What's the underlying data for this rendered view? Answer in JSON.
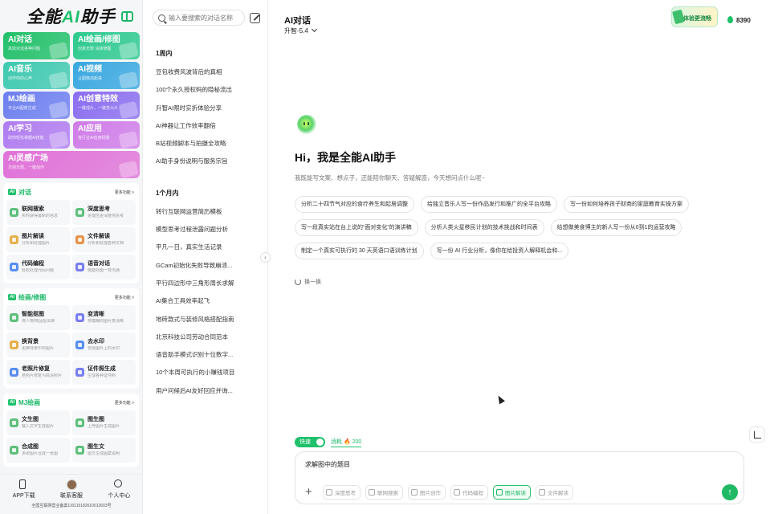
{
  "sidebar": {
    "logo_prefix": "全能",
    "logo_ai": "AI",
    "logo_suffix": "助手",
    "tiles": [
      {
        "title": "AI对话",
        "sub": "高效对话各种问题",
        "color": "#22c06a"
      },
      {
        "title": "AI绘画/修图",
        "sub": "创意无限 涂抹修图",
        "color": "#2dc98f"
      },
      {
        "title": "AI音乐",
        "sub": "创作你的心声",
        "color": "#3fc9b0"
      },
      {
        "title": "AI视频",
        "sub": "让图像动起来",
        "color": "#3aa8e0"
      },
      {
        "title": "MJ绘画",
        "sub": "专业AI图像生成",
        "color": "#6d7ff0"
      },
      {
        "title": "AI创意特效",
        "sub": "一键成片，一键变大片",
        "color": "#8a6df0"
      },
      {
        "title": "AI学习",
        "sub": "助你轻松掌握AI技能",
        "color": "#b07cf0"
      },
      {
        "title": "AI应用",
        "sub": "各行业AI应用场景",
        "color": "#d07ce8"
      },
      {
        "title": "AI灵感广场",
        "sub": "灵感无限，一键创作",
        "color": "#e072d8"
      }
    ],
    "sections": [
      {
        "badge": "AI",
        "title": "对话",
        "more": "更多功能 >",
        "items": [
          {
            "title": "联网搜索",
            "sub": "实时获得最新的信息",
            "color": "#5fbf7c"
          },
          {
            "title": "深度思考",
            "sub": "更理性更深度地思考",
            "color": "#5fbf7c"
          },
          {
            "title": "图片解读",
            "sub": "分析和处理图片",
            "color": "#e6b04a"
          },
          {
            "title": "文件解读",
            "sub": "分析和处理各种文档",
            "color": "#e6914a"
          },
          {
            "title": "代码编程",
            "sub": "轻松处理代码问题",
            "color": "#5a8ef0"
          },
          {
            "title": "语音对话",
            "sub": "像面对面一样沟通",
            "color": "#7a7ef0"
          }
        ]
      },
      {
        "badge": "AI",
        "title": "绘画/修图",
        "more": "更多功能 >",
        "items": [
          {
            "title": "智能抠图",
            "sub": "将人物/物品抠出来",
            "color": "#5fbf7c"
          },
          {
            "title": "变清晰",
            "sub": "将模糊的图片变清晰",
            "color": "#7a7ef0"
          },
          {
            "title": "换背景",
            "sub": "更换背景中的图片",
            "color": "#e6b04a"
          },
          {
            "title": "去水印",
            "sub": "去除图片上的水印",
            "color": "#5a8ef0"
          },
          {
            "title": "老照片修复",
            "sub": "老照片修复为高清照片",
            "color": "#5a8ef0"
          },
          {
            "title": "证件照生成",
            "sub": "生成各种证件照",
            "color": "#7a7ef0"
          }
        ]
      },
      {
        "badge": "AI",
        "title": "MJ绘画",
        "more": "更多功能 >",
        "items": [
          {
            "title": "文生图",
            "sub": "输入文字生成图片",
            "color": "#5fbf7c"
          },
          {
            "title": "图生图",
            "sub": "上传图片生成图片",
            "color": "#5fbf7c"
          },
          {
            "title": "合成图",
            "sub": "多张图片合成一张图",
            "color": "#5fbf7c"
          },
          {
            "title": "图生文",
            "sub": "图文生成图案说明",
            "color": "#5fbf7c"
          }
        ]
      }
    ],
    "bottom": [
      {
        "label": "APP下载"
      },
      {
        "label": "联系客服"
      },
      {
        "label": "个人中心"
      }
    ],
    "icp": "全国互联网营业备案110115182610012603号"
  },
  "history": {
    "search_placeholder": "输入要搜索的对话名称",
    "groups": [
      {
        "label": "1周内",
        "items": [
          "豆包收费风波背后的真相",
          "100个永久授权码的隐秘流出",
          "升智AI限时实折体验分享",
          "AI神器让工作效率翻倍",
          "B站视频脚本与拍摄全攻略",
          "AI助手身份说明与服务宗旨"
        ]
      },
      {
        "label": "1个月内",
        "items": [
          "转行互联网运营简历模板",
          "模型思考过程泄露问题分析",
          "平凡一日，真实生活记录",
          "GCam初始化失败导致崩溃...",
          "平行四边形中三角形周长求解",
          "AI集合工具效率起飞",
          "地砖款式与装修风格搭配指南",
          "北京科技公司劳动合同范本",
          "语音助手模式识别十位数字...",
          "10个本周可执行的小赚钱项目",
          "用户问候后AI友好回应并询..."
        ]
      }
    ]
  },
  "main": {
    "title": "AI对话",
    "model": "升智-5.4",
    "promo": "体验更流畅",
    "points": "8390",
    "greeting": "Hi，我是全能AI助手",
    "intro": "我既能写文案、想点子，还能陪你聊天、答疑解惑，今天想问点什么呢~",
    "suggestions": [
      "分析二十四节气对应的食疗养生和起居调整",
      "给独立音乐人写一份作品发行和推广的全平台攻略",
      "写一份如何培养孩子财商的家庭教育实操方案",
      "写一段真实站在台上说的“面对变化”的演讲稿",
      "分析人类火星移民计划的技术挑战和时间表",
      "给想做美食博主的新人写一份从0到1的运营攻略",
      "制定一个真实可执行的 30 天英语口语训练计划",
      "写一份 AI 行业分析，像你在给投资人解释机会和..."
    ],
    "refresh_label": "换一换",
    "mode_label": "快速",
    "cost_label": "消耗 🔥 200",
    "input_text": "求解图中的题目",
    "tools": [
      {
        "label": "深度思考",
        "active": false
      },
      {
        "label": "联网搜索",
        "active": false
      },
      {
        "label": "图片创作",
        "active": false
      },
      {
        "label": "代码编程",
        "active": false
      },
      {
        "label": "图片解读",
        "active": true
      },
      {
        "label": "文件解读",
        "active": false
      }
    ],
    "accent": "#1fc16b"
  }
}
